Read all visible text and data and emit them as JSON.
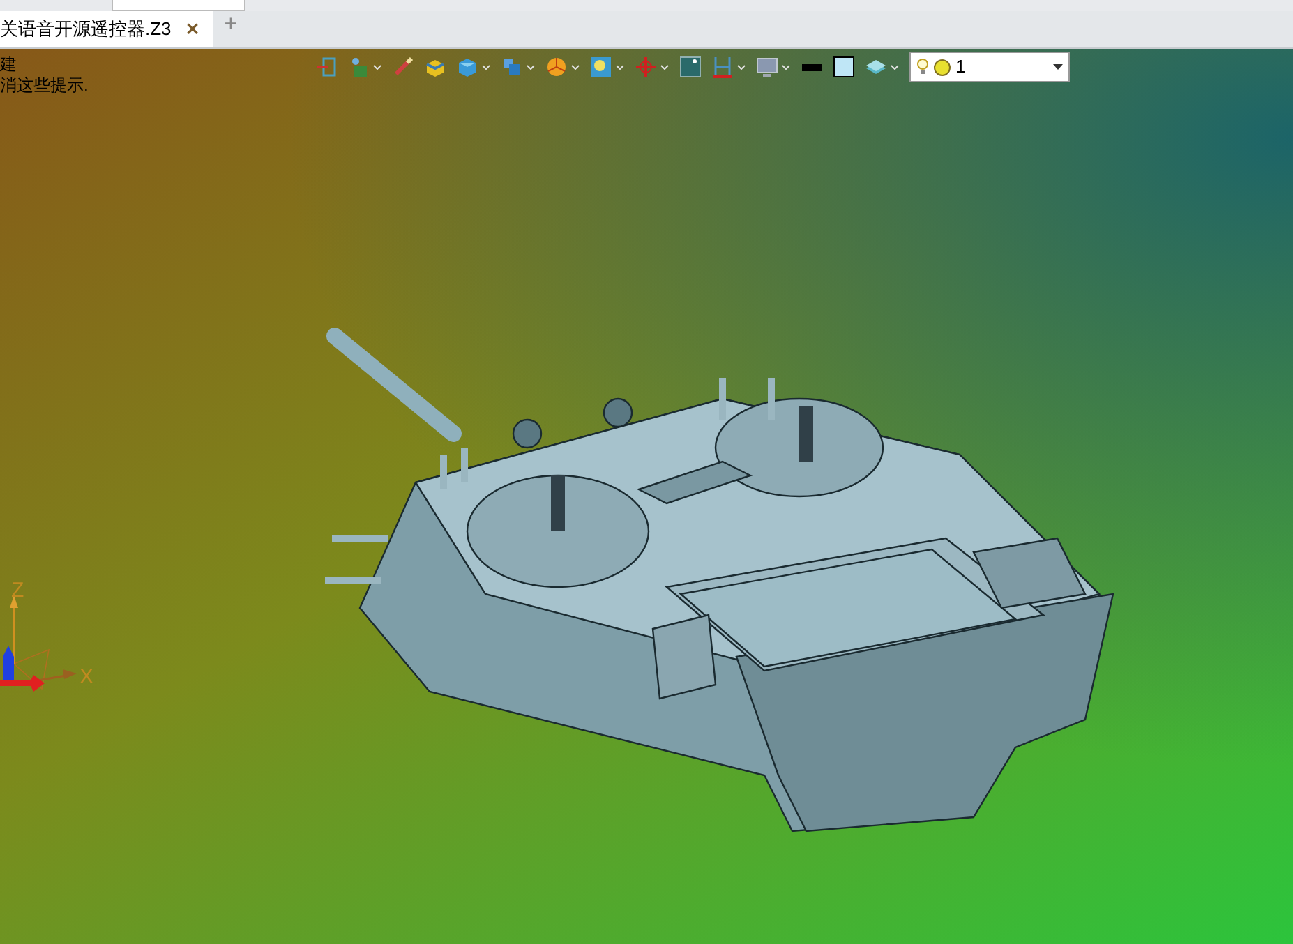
{
  "tabs": [
    {
      "label": "关语音开源遥控器.Z3",
      "selected": true,
      "close": "✕"
    }
  ],
  "new_tab": "+",
  "hints": [
    "建",
    "消这些提示."
  ],
  "layer_dropdown": {
    "value": "1"
  },
  "triad": {
    "z": "Z",
    "x": "X"
  }
}
